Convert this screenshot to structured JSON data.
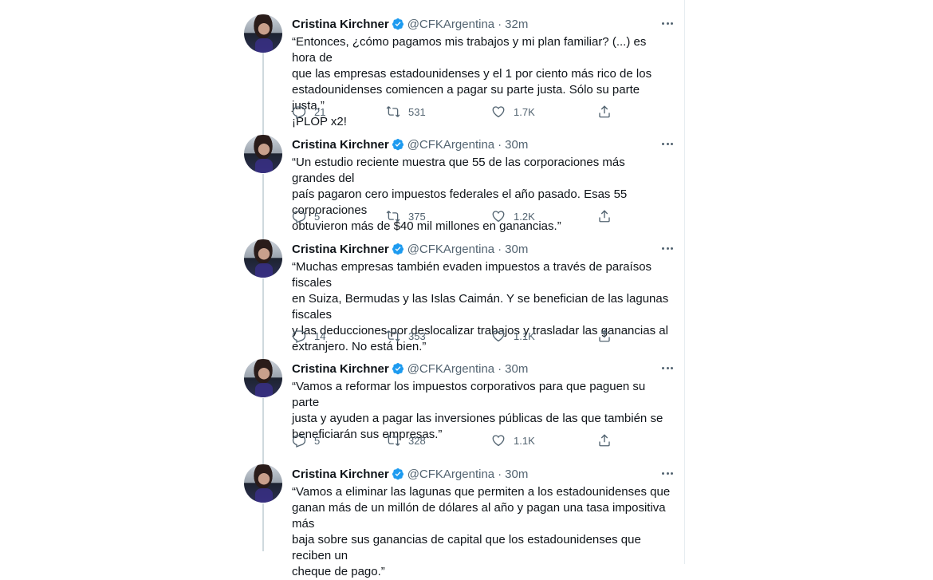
{
  "account": {
    "name": "Cristina Kirchner",
    "handle": "@CFKArgentina"
  },
  "tweets": [
    {
      "time": "32m",
      "text": "“Entonces, ¿cómo pagamos mis trabajos y mi plan familiar? (...) es hora de\nque las empresas estadounidenses y el 1 por ciento más rico de los\nestadounidenses comiencen a pagar su parte justa. Sólo su parte justa.”\n¡PLOP x2!",
      "replies": "21",
      "retweets": "531",
      "likes": "1.7K"
    },
    {
      "time": "30m",
      "text": "“Un estudio reciente muestra que 55 de las corporaciones más grandes del\npaís pagaron cero impuestos federales el año pasado. Esas 55 corporaciones\nobtuvieron más de $40 mil millones en ganancias.”",
      "replies": "5",
      "retweets": "375",
      "likes": "1.2K"
    },
    {
      "time": "30m",
      "text": "“Muchas empresas también evaden impuestos a través de paraísos fiscales\nen Suiza, Bermudas y las Islas Caimán. Y se benefician de las lagunas fiscales\ny las deducciones por deslocalizar trabajos y trasladar las ganancias al\nextranjero. No está bien.”",
      "replies": "14",
      "retweets": "353",
      "likes": "1.1K"
    },
    {
      "time": "30m",
      "text": "“Vamos a reformar los impuestos corporativos para que paguen su parte\njusta y ayuden a pagar las inversiones públicas de las que también se\nbeneficiarán sus empresas.”",
      "replies": "5",
      "retweets": "328",
      "likes": "1.1K"
    },
    {
      "time": "30m",
      "text": "“Vamos a eliminar las lagunas que permiten a los estadounidenses que\nganan más de un millón de dólares al año y pagan una tasa impositiva más\nbaja sobre sus ganancias de capital que los estadounidenses que reciben un\ncheque de pago.”",
      "replies": null,
      "retweets": null,
      "likes": null
    }
  ],
  "separator": "·",
  "icons": {
    "verified": "verified-badge-icon",
    "more": "more-icon",
    "reply": "reply-icon",
    "retweet": "retweet-icon",
    "like": "like-icon",
    "share": "share-icon"
  },
  "colors": {
    "verified_blue": "#1d9bf0",
    "secondary_text": "#536471",
    "thread_line": "#cfd9de"
  }
}
